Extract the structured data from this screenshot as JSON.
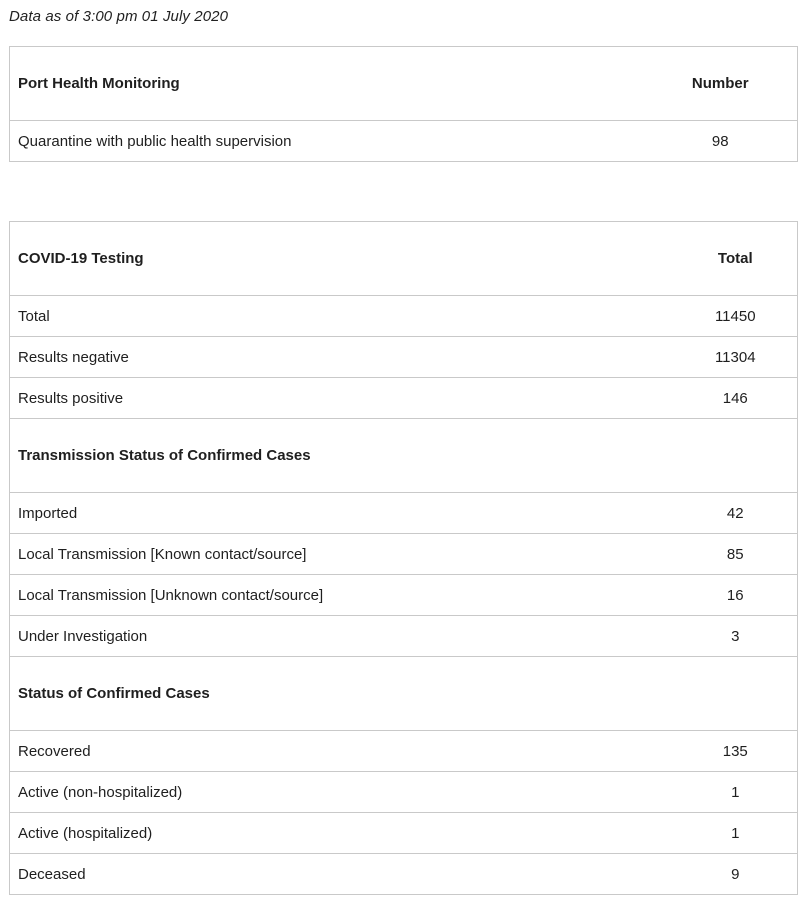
{
  "as_of": "Data as of 3:00 pm 01 July 2020",
  "port_health": {
    "title": "Port Health Monitoring",
    "column": "Number",
    "rows": [
      {
        "label": "Quarantine with public health supervision",
        "value": "98"
      }
    ]
  },
  "testing": {
    "title": "COVID-19 Testing",
    "column": "Total",
    "rows": [
      {
        "label": "Total",
        "value": "11450"
      },
      {
        "label": "Results negative",
        "value": "11304"
      },
      {
        "label": "Results positive",
        "value": "146"
      }
    ],
    "transmission_title": "Transmission Status of Confirmed Cases",
    "transmission_rows": [
      {
        "label": "Imported",
        "value": "42"
      },
      {
        "label": "Local Transmission [Known contact/source]",
        "value": "85"
      },
      {
        "label": "Local Transmission [Unknown contact/source]",
        "value": "16"
      },
      {
        "label": "Under Investigation",
        "value": "3"
      }
    ],
    "status_title": "Status of Confirmed Cases",
    "status_rows": [
      {
        "label": "Recovered",
        "value": "135"
      },
      {
        "label": "Active (non-hospitalized)",
        "value": "1"
      },
      {
        "label": "Active (hospitalized)",
        "value": "1"
      },
      {
        "label": "Deceased",
        "value": "9"
      }
    ]
  }
}
